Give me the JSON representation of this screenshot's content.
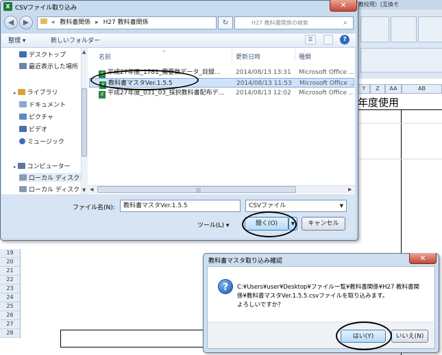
{
  "excel": {
    "ribbon_title": "教校用）[互換モ",
    "col_headers": [
      "Y",
      "Z",
      "AA",
      "AB"
    ],
    "cell_text": "年度使用",
    "row_numbers": [
      "19",
      "20",
      "21",
      "22",
      "23",
      "24",
      "25",
      "26",
      "27",
      "28"
    ]
  },
  "file_dialog": {
    "title": "CSVファイル取り込み",
    "close_label": "✕",
    "breadcrumb": {
      "chevron": "«",
      "path1": "教科書関係",
      "sep": "▸",
      "path2": "H27 教科書関係"
    },
    "search_placeholder": "H27 教科書関係の検索",
    "toolbar": {
      "organize": "整理 ▾",
      "new_folder": "新しいフォルダー"
    },
    "nav": [
      {
        "label": "デスクトップ",
        "icon": "desktop-icon",
        "color": "#3a6fb0"
      },
      {
        "label": "最近表示した場所",
        "icon": "recent-places-icon",
        "color": "#6b86a8"
      },
      {
        "label": "ライブラリ",
        "icon": "library-icon",
        "color": "#d6a53a"
      },
      {
        "label": "ドキュメント",
        "icon": "documents-icon",
        "color": "#8aa8cc"
      },
      {
        "label": "ピクチャ",
        "icon": "pictures-icon",
        "color": "#5c8ac4"
      },
      {
        "label": "ビデオ",
        "icon": "videos-icon",
        "color": "#4a6fa8"
      },
      {
        "label": "ミュージック",
        "icon": "music-icon",
        "color": "#3d6db8"
      },
      {
        "label": "コンピューター",
        "icon": "computer-icon",
        "color": "#5f7898"
      },
      {
        "label": "ローカル ディスク",
        "icon": "disk-icon",
        "color": "#8a9bb0"
      },
      {
        "label": "ローカル ディスク",
        "icon": "disk-icon",
        "color": "#8a9bb0"
      }
    ],
    "columns": {
      "name": "名前",
      "modified": "更新日時",
      "type": "種類"
    },
    "files": [
      {
        "name": "平成27年度_1781_需要数データ_目録...",
        "date": "2014/08/13 13:31",
        "type": "Microsoft Office ..."
      },
      {
        "name": "教科書マスタVer.1.5.5",
        "date": "2014/08/13 11:53",
        "type": "Microsoft Office ..."
      },
      {
        "name": "平成27年度_031_03_採択教科書配布デ...",
        "date": "2014/08/13 12:02",
        "type": "Microsoft Office ..."
      }
    ],
    "filename_label": "ファイル名(N):",
    "filename_value": "教科書マスタVer.1.5.5",
    "filetype_value": "CSVファイル",
    "tools_label": "ツール(L) ▾",
    "open_label": "開く(O)",
    "cancel_label": "キャンセル"
  },
  "confirm_dialog": {
    "title": "教科書マスタ取り込み確認",
    "close_label": "✕",
    "line1": "C:¥Users¥user¥Desktop¥ファイル一覧¥教科書関係¥H27 教科書関",
    "line2": "係¥教科書マスタVer.1.5.5.csvファイルを取り込みます。",
    "line3": "よろしいですか？",
    "yes_label": "はい(Y)",
    "no_label": "いいえ(N)"
  },
  "colors": {
    "accent": "#3c7fb1",
    "selection": "#cfe3fa",
    "dialog_frame": "#c9dbef"
  }
}
